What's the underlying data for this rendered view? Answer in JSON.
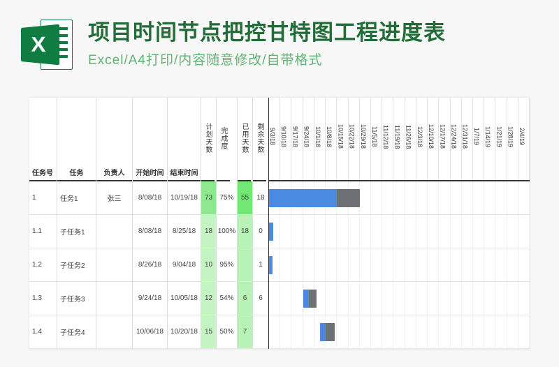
{
  "icon": {
    "letter": "X"
  },
  "title": {
    "main": "项目时间节点把控甘特图工程进度表",
    "sub": "Excel/A4打印/内容随意修改/自带格式"
  },
  "headers": {
    "task_no": "任务号",
    "task": "任务",
    "person": "负责人",
    "start": "开始时间",
    "end": "结束时间",
    "plan_days": "计划天数",
    "progress": "完成度",
    "used_days": "已用天数",
    "remain_days": "剩余天数"
  },
  "date_cols": [
    "9/3/18",
    "9/10/18",
    "9/17/18",
    "9/24/18",
    "10/1/18",
    "10/8/18",
    "10/15/18",
    "10/22/18",
    "10/29/18",
    "11/5/18",
    "11/12/18",
    "11/19/18",
    "11/26/18",
    "12/3/18",
    "12/10/18",
    "12/17/18",
    "12/24/18",
    "12/31/18",
    "1/7/19",
    "1/14/19",
    "1/21/19",
    "1/28/19",
    "2/4/19"
  ],
  "rows": [
    {
      "no": "1",
      "task": "任务1",
      "person": "张三",
      "start": "8/08/18",
      "end": "10/19/18",
      "days": "73",
      "prog": "75%",
      "used": "55",
      "remain": "18",
      "bar_blue": [
        0,
        6
      ],
      "bar_grey": [
        6,
        8
      ]
    },
    {
      "no": "1.1",
      "task": "子任务1",
      "person": "",
      "start": "8/08/18",
      "end": "8/25/18",
      "days": "18",
      "prog": "100%",
      "used": "18",
      "remain": "0",
      "bar_blue": [
        0,
        0.4
      ],
      "bar_grey": null
    },
    {
      "no": "1.2",
      "task": "子任务2",
      "person": "",
      "start": "8/26/18",
      "end": "9/04/18",
      "days": "10",
      "prog": "95%",
      "used": "",
      "remain": "1",
      "bar_blue": [
        0,
        0.3
      ],
      "bar_grey": null
    },
    {
      "no": "1.3",
      "task": "子任务3",
      "person": "",
      "start": "9/24/18",
      "end": "10/05/18",
      "days": "12",
      "prog": "54%",
      "used": "6",
      "remain": "6",
      "bar_lblue": [
        3,
        3.8
      ],
      "bar_blue": [
        3,
        3.5
      ],
      "bar_grey": [
        3.5,
        4.2
      ]
    },
    {
      "no": "1.4",
      "task": "子任务4",
      "person": "",
      "start": "10/06/18",
      "end": "10/20/18",
      "days": "15",
      "prog": "50%",
      "used": "7",
      "remain": "",
      "bar_lblue": [
        4.5,
        5.5
      ],
      "bar_blue": [
        4.5,
        5
      ],
      "bar_grey": [
        5,
        5.8
      ]
    }
  ],
  "chart_data": {
    "type": "table",
    "title": "项目时间节点把控甘特图工程进度表",
    "columns": [
      "任务号",
      "任务",
      "负责人",
      "开始时间",
      "结束时间",
      "计划天数",
      "完成度",
      "已用天数",
      "剩余天数"
    ],
    "records": [
      [
        "1",
        "任务1",
        "张三",
        "8/08/18",
        "10/19/18",
        73,
        "75%",
        55,
        18
      ],
      [
        "1.1",
        "子任务1",
        "",
        "8/08/18",
        "8/25/18",
        18,
        "100%",
        18,
        0
      ],
      [
        "1.2",
        "子任务2",
        "",
        "8/26/18",
        "9/04/18",
        10,
        "95%",
        null,
        1
      ],
      [
        "1.3",
        "子任务3",
        "",
        "9/24/18",
        "10/05/18",
        12,
        "54%",
        6,
        6
      ],
      [
        "1.4",
        "子任务4",
        "",
        "10/06/18",
        "10/20/18",
        15,
        "50%",
        7,
        null
      ]
    ],
    "gantt_date_range": [
      "9/3/18",
      "2/4/19"
    ],
    "gantt_week_starts": [
      "9/3/18",
      "9/10/18",
      "9/17/18",
      "9/24/18",
      "10/1/18",
      "10/8/18",
      "10/15/18",
      "10/22/18",
      "10/29/18",
      "11/5/18",
      "11/12/18",
      "11/19/18",
      "11/26/18",
      "12/3/18",
      "12/10/18",
      "12/17/18",
      "12/24/18",
      "12/31/18",
      "1/7/19",
      "1/14/19",
      "1/21/19",
      "1/28/19",
      "2/4/19"
    ]
  }
}
